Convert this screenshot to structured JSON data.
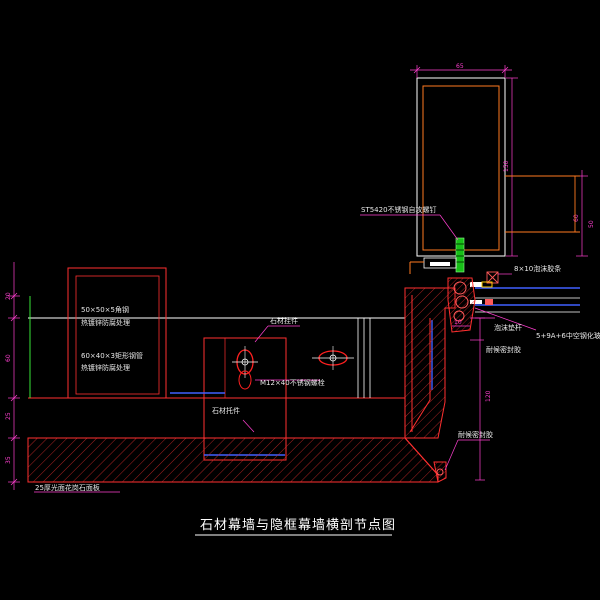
{
  "title": "石材幕墙与隐框幕墙横剖节点图",
  "labels": {
    "screw": "ST5420不锈钢自攻螺钉",
    "weathering": "8×10泡沫胶条",
    "angle1": "50×50×5角钢",
    "angle2": "热镀锌防腐处理",
    "tube1": "60×40×3矩形钢管",
    "tube2": "热镀锌防腐处理",
    "hanger": "石材挂件",
    "bolt": "M12×40不锈钢螺栓",
    "tray": "石材托件",
    "foam": "泡沫垫杆",
    "glass": "5+9A+6中空钢化玻璃",
    "sealant": "耐候密封胶",
    "bottomSealant": "耐候密封胶",
    "stoneFinish": "25厚光面花岗石面板"
  },
  "dimensions": {
    "top": "65",
    "right1": "150",
    "right2": "60",
    "right3": "50",
    "joint": "10",
    "rightLower": "120",
    "left1": "20",
    "left2": "60",
    "left3": "25",
    "left4": "35"
  },
  "colors": {
    "background": "#000000",
    "outline": "#ff3030",
    "dimension": "#ff3fd0",
    "glass": "#4060ff",
    "frame": "#ff7a20",
    "sealant": "#18c018"
  }
}
